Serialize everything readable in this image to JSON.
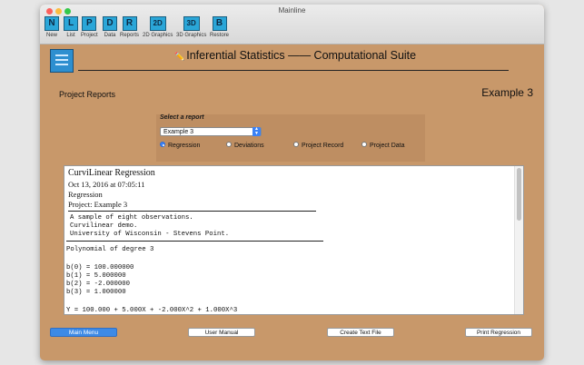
{
  "window": {
    "title": "Mainline"
  },
  "toolbar": [
    {
      "letter": "N",
      "label": "New"
    },
    {
      "letter": "L",
      "label": "List"
    },
    {
      "letter": "P",
      "label": "Project"
    },
    {
      "letter": "D",
      "label": "Data"
    },
    {
      "letter": "R",
      "label": "Reports"
    },
    {
      "letter": "2D",
      "label": "2D Graphics"
    },
    {
      "letter": "3D",
      "label": "3D Graphics"
    },
    {
      "letter": "B",
      "label": "Restore"
    }
  ],
  "header": {
    "title": "Inferential Statistics —— Computational Suite",
    "icon": "pencil-icon"
  },
  "page": {
    "section": "Project Reports",
    "project_name": "Example 3"
  },
  "report_select": {
    "label": "Select a report",
    "selected": "Example 3",
    "options": [
      "Regression",
      "Deviations",
      "Project Record",
      "Project Data"
    ],
    "checked": "Regression"
  },
  "report": {
    "title": "CurviLinear Regression",
    "date": "Oct 13, 2016 at 07:05:11",
    "type": "Regression",
    "project": "Project: Example 3",
    "description": [
      "A sample of eight observations.",
      "Curvilinear demo.",
      "University of Wisconsin - Stevens Point."
    ],
    "polynomial": "Polynomial of degree 3",
    "coefficients": [
      "b(0) = 100.000000",
      "b(1) = 5.000000",
      "b(2) = -2.000000",
      "b(3) = 1.000000"
    ],
    "equation": "Y = 100.000 + 5.000X + -2.000X^2 + 1.000X^3"
  },
  "buttons": {
    "main_menu": "Main Menu",
    "user_manual": "User Manual",
    "create_text_file": "Create Text File",
    "print_regression": "Print Regression"
  },
  "colors": {
    "background": "#c8986a",
    "accent": "#3d8ae6",
    "toolbar_icon": "#2aa6d8"
  }
}
